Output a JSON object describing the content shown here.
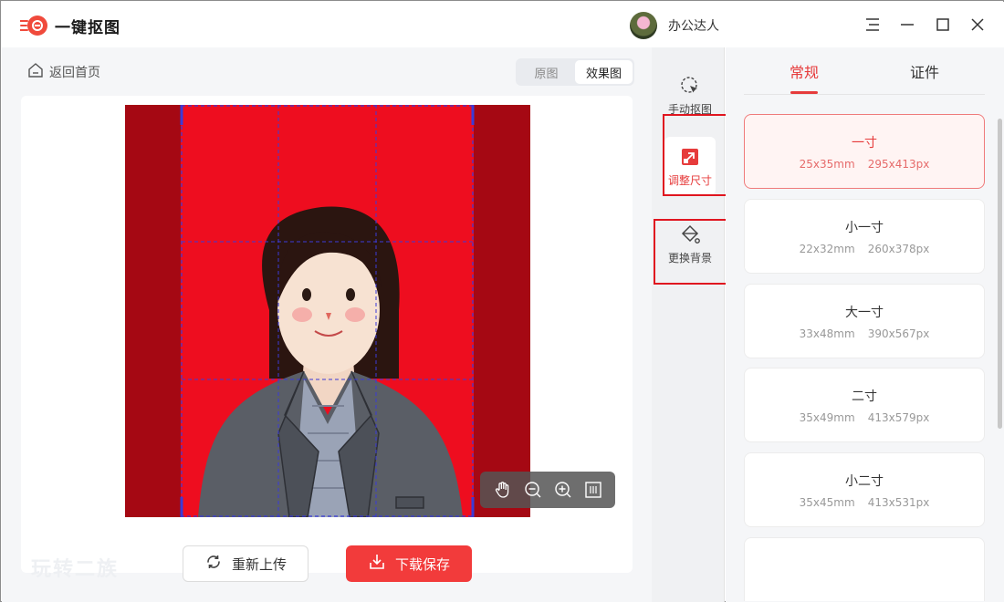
{
  "app": {
    "title": "一键抠图"
  },
  "user": {
    "name": "办公达人"
  },
  "nav": {
    "back_label": "返回首页"
  },
  "view_toggle": {
    "original_label": "原图",
    "result_label": "效果图",
    "active": "result"
  },
  "actions": {
    "reupload_label": "重新上传",
    "download_label": "下载保存"
  },
  "tools": [
    {
      "label": "手动抠图",
      "icon": "cursor-select-icon"
    },
    {
      "label": "调整尺寸",
      "icon": "resize-icon",
      "active": true
    },
    {
      "label": "更换背景",
      "icon": "paint-bucket-icon"
    }
  ],
  "tabs": [
    {
      "label": "常规",
      "active": true
    },
    {
      "label": "证件"
    }
  ],
  "sizes": [
    {
      "name": "一寸",
      "mm": "25x35mm",
      "px": "295x413px",
      "active": true
    },
    {
      "name": "小一寸",
      "mm": "22x32mm",
      "px": "260x378px"
    },
    {
      "name": "大一寸",
      "mm": "33x48mm",
      "px": "390x567px"
    },
    {
      "name": "二寸",
      "mm": "35x49mm",
      "px": "413x579px"
    },
    {
      "name": "小二寸",
      "mm": "35x45mm",
      "px": "413x531px"
    }
  ],
  "watermark": "玩转二族",
  "colors": {
    "accent": "#e63b3b",
    "background_red": "#ee0d1f",
    "outside_crop": "#a50813"
  }
}
